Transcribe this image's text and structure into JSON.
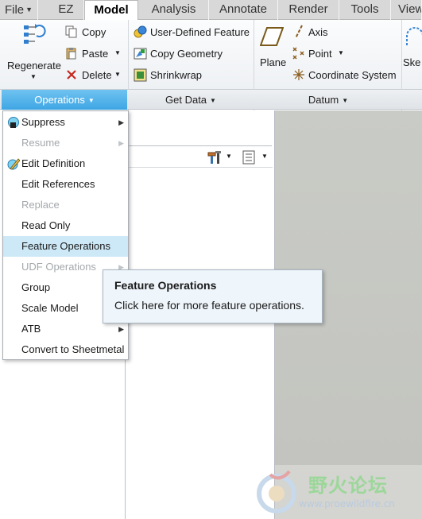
{
  "tabs": [
    {
      "label": "File",
      "has_caret": true
    },
    {
      "label": "EZ"
    },
    {
      "label": "Model",
      "active": true
    },
    {
      "label": "Analysis"
    },
    {
      "label": "Annotate"
    },
    {
      "label": "Render"
    },
    {
      "label": "Tools"
    },
    {
      "label": "View"
    }
  ],
  "ribbon": {
    "regenerate": "Regenerate",
    "copy": "Copy",
    "paste": "Paste",
    "delete": "Delete",
    "user_defined_feature": "User-Defined Feature",
    "copy_geometry": "Copy Geometry",
    "shrinkwrap": "Shrinkwrap",
    "plane": "Plane",
    "axis": "Axis",
    "point": "Point",
    "coordinate_system": "Coordinate System",
    "sketch": "Ske"
  },
  "groups": {
    "operations": "Operations",
    "get_data": "Get Data",
    "datum": "Datum"
  },
  "menu": {
    "items": [
      {
        "label": "Suppress",
        "submenu": true,
        "icon": "suppress-icon"
      },
      {
        "label": "Resume",
        "submenu": true,
        "disabled": true
      },
      {
        "label": "Edit Definition",
        "icon": "edit-definition-icon"
      },
      {
        "label": "Edit References"
      },
      {
        "label": "Replace",
        "disabled": true
      },
      {
        "label": "Read Only"
      },
      {
        "label": "Feature Operations",
        "highlighted": true
      },
      {
        "label": "UDF Operations",
        "submenu": true,
        "disabled": true
      },
      {
        "label": "Group"
      },
      {
        "label": "Scale Model"
      },
      {
        "label": "ATB",
        "submenu": true
      },
      {
        "label": "Convert to Sheetmetal"
      }
    ]
  },
  "tooltip": {
    "title": "Feature Operations",
    "body": "Click here for more feature operations."
  },
  "watermark": {
    "brand": "野火论坛",
    "url": "www.proewildfire.cn"
  },
  "colors": {
    "accent": "#3ea6e4",
    "highlight": "#cde8f6",
    "tooltip_bg": "#eef5fb"
  }
}
